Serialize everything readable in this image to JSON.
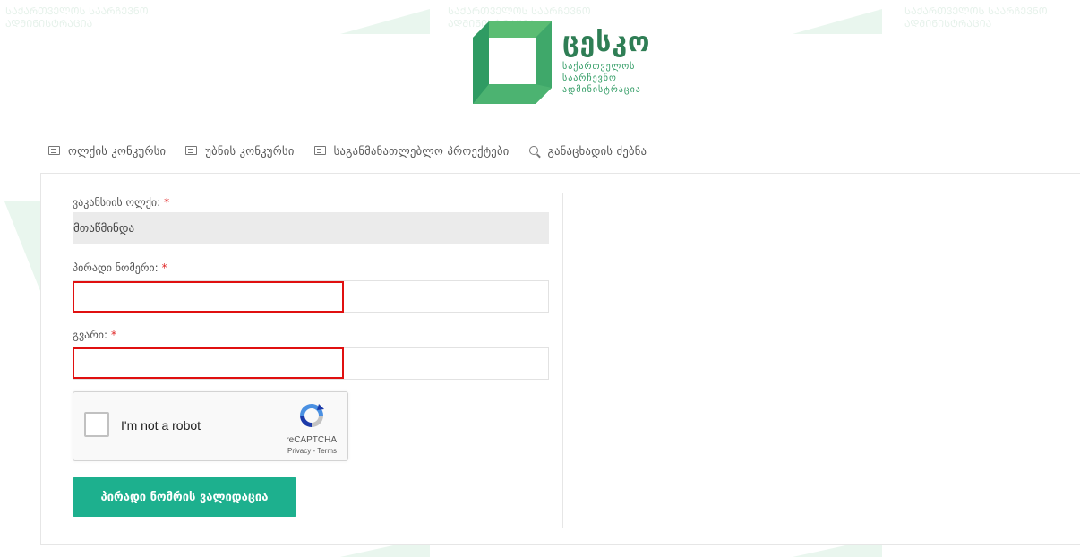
{
  "header": {
    "logo_title": "ცესკო",
    "logo_sub_1": "საქართველოს",
    "logo_sub_2": "საარჩევნო",
    "logo_sub_3": "ადმინისტრაცია"
  },
  "nav": {
    "items": [
      {
        "label": "ოლქის კონკურსი",
        "icon": "list-icon"
      },
      {
        "label": "უბნის კონკურსი",
        "icon": "list-icon"
      },
      {
        "label": "საგანმანათლებლო პროექტები",
        "icon": "list-icon"
      },
      {
        "label": "განაცხადის ძებნა",
        "icon": "search-icon"
      }
    ]
  },
  "form": {
    "district_label": "ვაკანსიის ოლქი:",
    "district_value": "მთაწმინდა",
    "personal_number_label": "პირადი ნომერი:",
    "personal_number_value": "",
    "surname_label": "გვარი:",
    "surname_value": "",
    "required_mark": "*",
    "submit_label": "პირადი ნომრის ვალიდაცია"
  },
  "captcha": {
    "text": "I'm not a robot",
    "brand": "reCAPTCHA",
    "terms": "Privacy - Terms"
  },
  "colors": {
    "accent": "#1db08e",
    "brand_green": "#2f9b63",
    "required": "#e02727",
    "highlight": "#e01010"
  }
}
